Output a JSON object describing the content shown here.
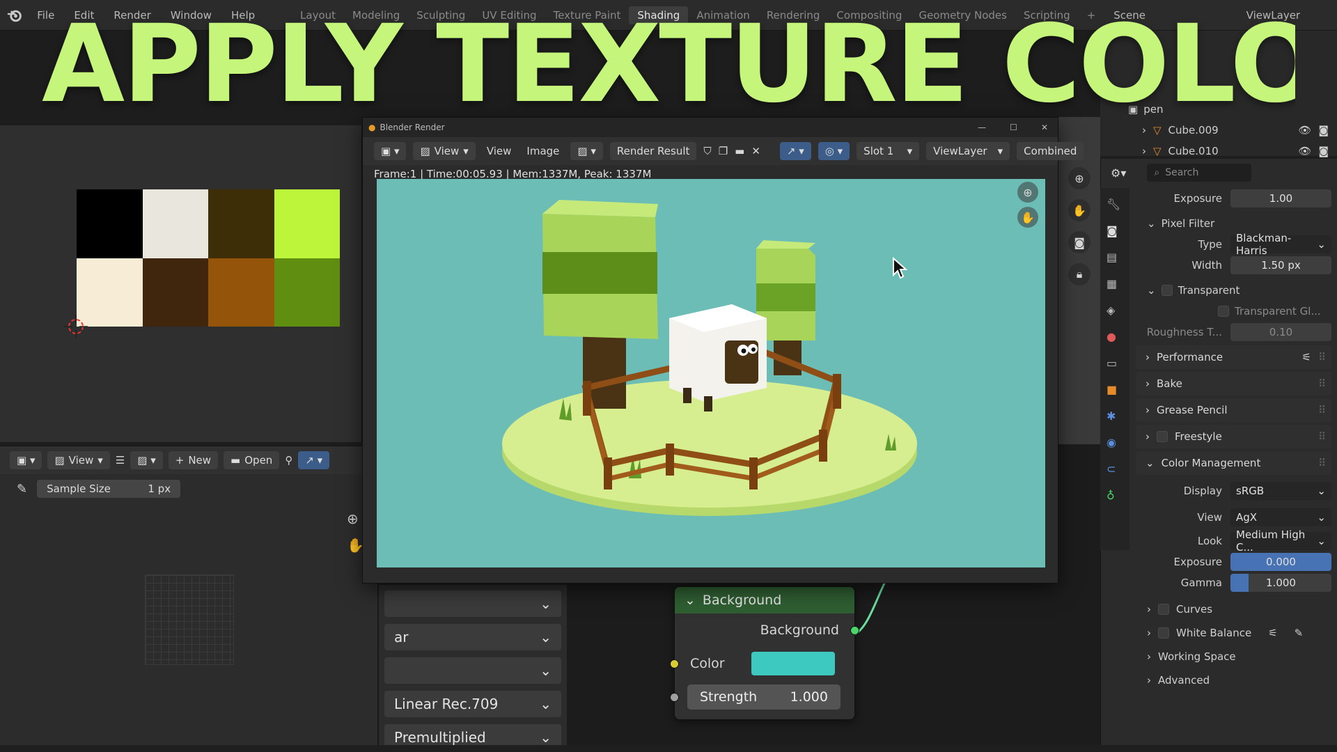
{
  "headline": "APPLY TEXTURE COLOURS",
  "topbar": {
    "menus": [
      "File",
      "Edit",
      "Render",
      "Window",
      "Help"
    ],
    "workspaces": [
      "Layout",
      "Modeling",
      "Sculpting",
      "UV Editing",
      "Texture Paint",
      "Shading",
      "Animation",
      "Rendering",
      "Compositing",
      "Geometry Nodes",
      "Scripting"
    ],
    "active_workspace": "Shading",
    "scene": "Scene",
    "view_layer": "ViewLayer"
  },
  "palette_colors": [
    "#000000",
    "#e9e6de",
    "#3e2e08",
    "#bdf53a",
    "#f7ecd6",
    "#3f260d",
    "#94550b",
    "#5f8e10"
  ],
  "image_editor": {
    "view": "View",
    "new_label": "New",
    "open_label": "Open",
    "sample_size_label": "Sample Size",
    "sample_size_value": "1 px"
  },
  "render_window": {
    "title": "Blender Render",
    "menu_view": "View",
    "menu_view2": "View",
    "menu_image": "Image",
    "render_result": "Render Result",
    "slot": "Slot 1",
    "view_layer": "ViewLayer",
    "pass": "Combined",
    "info": "Frame:1 | Time:00:05.93 | Mem:1337M, Peak: 1337M"
  },
  "node_editor": {
    "dropdowns": [
      "",
      "ar",
      "",
      "Linear Rec.709",
      "Premultiplied"
    ],
    "background_node": {
      "title": "Background",
      "output": "Background",
      "color_label": "Color",
      "color_value": "#3ec9c0",
      "strength_label": "Strength",
      "strength_value": "1.000"
    }
  },
  "outliner": {
    "items": [
      "pen",
      "Cube.009",
      "Cube.010"
    ]
  },
  "properties": {
    "search_placeholder": "Search",
    "exposure_label": "Exposure",
    "exposure_value": "1.00",
    "pixel_filter": "Pixel Filter",
    "type_label": "Type",
    "type_value": "Blackman-Harris",
    "width_label": "Width",
    "width_value": "1.50 px",
    "transparent": "Transparent",
    "transparent_glass": "Transparent Gl...",
    "roughness_label": "Roughness T...",
    "roughness_value": "0.10",
    "sections": [
      "Performance",
      "Bake",
      "Grease Pencil",
      "Freestyle"
    ],
    "color_management": "Color Management",
    "display_label": "Display",
    "display_value": "sRGB",
    "view_label": "View",
    "view_value": "AgX",
    "look_label": "Look",
    "look_value": "Medium High C...",
    "cm_exposure_label": "Exposure",
    "cm_exposure_value": "0.000",
    "gamma_label": "Gamma",
    "gamma_value": "1.000",
    "subsections": [
      "Curves",
      "White Balance",
      "Working Space",
      "Advanced"
    ]
  }
}
